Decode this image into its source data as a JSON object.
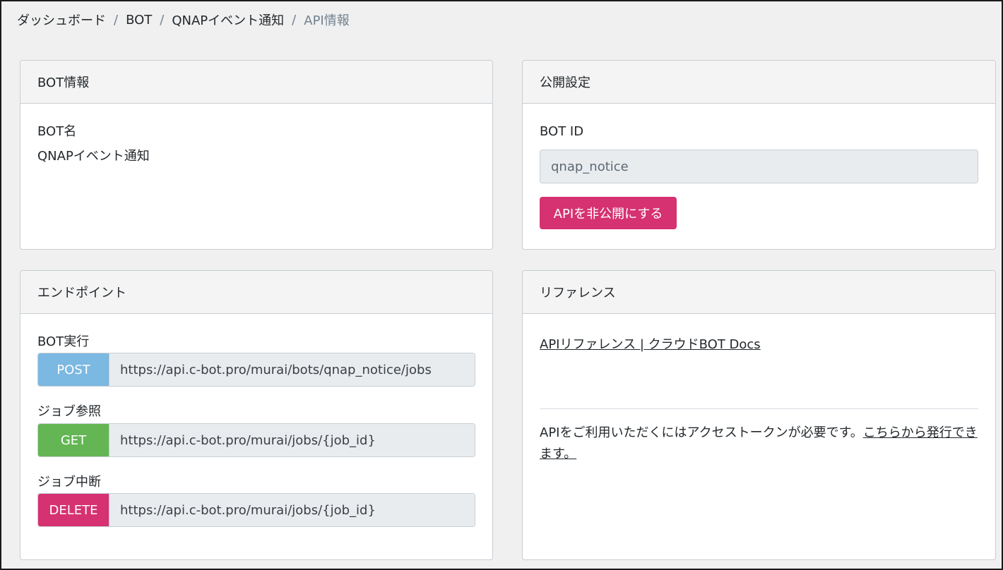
{
  "breadcrumb": {
    "items": [
      "ダッシュボード",
      "BOT",
      "QNAPイベント通知"
    ],
    "separator": "/",
    "current": "API情報"
  },
  "bot_info": {
    "header": "BOT情報",
    "name_label": "BOT名",
    "name_value": "QNAPイベント通知"
  },
  "public_settings": {
    "header": "公開設定",
    "bot_id_label": "BOT ID",
    "bot_id_value": "qnap_notice",
    "unpublish_button": "APIを非公開にする"
  },
  "endpoints": {
    "header": "エンドポイント",
    "items": [
      {
        "label": "BOT実行",
        "method": "POST",
        "url": "https://api.c-bot.pro/murai/bots/qnap_notice/jobs",
        "color": "#7bb8e2"
      },
      {
        "label": "ジョブ参照",
        "method": "GET",
        "url": "https://api.c-bot.pro/murai/jobs/{job_id}",
        "color": "#63b653"
      },
      {
        "label": "ジョブ中断",
        "method": "DELETE",
        "url": "https://api.c-bot.pro/murai/jobs/{job_id}",
        "color": "#d63170"
      }
    ]
  },
  "reference": {
    "header": "リファレンス",
    "docs_link": "APIリファレンス | クラウドBOT Docs",
    "note_text": "APIをご利用いただくにはアクセストークンが必要です。",
    "note_link": "こちらから発行できます。"
  },
  "colors": {
    "accent_pink": "#d63170",
    "post_blue": "#7bb8e2",
    "get_green": "#63b653",
    "delete_pink": "#d63170"
  }
}
